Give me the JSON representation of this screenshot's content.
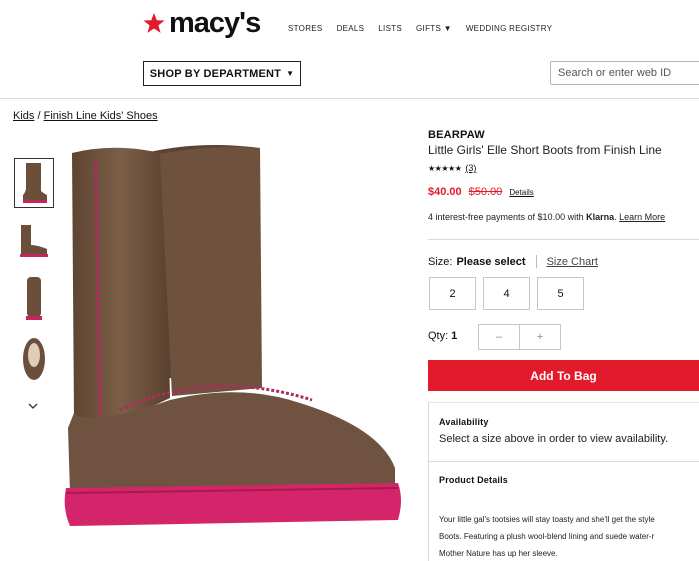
{
  "header": {
    "logo_text": "macy's",
    "nav": [
      "STORES",
      "DEALS",
      "LISTS",
      "GIFTS ▼",
      "WEDDING REGISTRY"
    ],
    "shop_button": "SHOP BY DEPARTMENT",
    "search_placeholder": "Search or enter web ID",
    "brand_color": "#e21a2c"
  },
  "breadcrumb": {
    "items": [
      "Kids",
      "Finish Line Kids' Shoes"
    ],
    "separator": "/"
  },
  "product": {
    "brand": "BEARPAW",
    "title": "Little Girls' Elle Short Boots from Finish Line",
    "stars": "★★★★★",
    "rating_value": 5,
    "review_count": "(3)",
    "sale_price": "$40.00",
    "original_price": "$50.00",
    "price_details": "Details",
    "klarna_pre": "4 interest-free payments of $10.00 with ",
    "klarna_brand": "Klarna",
    "klarna_sep": ". ",
    "klarna_learn": "Learn More",
    "size_label": "Size:",
    "size_selected": "Please select",
    "size_chart": "Size Chart",
    "sizes": [
      "2",
      "4",
      "5"
    ],
    "qty_label": "Qty:",
    "qty_value": "1",
    "qty_minus": "–",
    "qty_plus": "+",
    "add_to_bag": "Add To Bag",
    "availability_heading": "Availability",
    "availability_text": "Select a size above in order to view availability.",
    "details_heading": "Product Details",
    "details_lines": [
      "Your little gal's tootsies will stay toasty and she'll get the style",
      "Boots. Featuring a plush wool-blend lining and suede water-r",
      "Mother Nature has up her sleeve."
    ]
  }
}
